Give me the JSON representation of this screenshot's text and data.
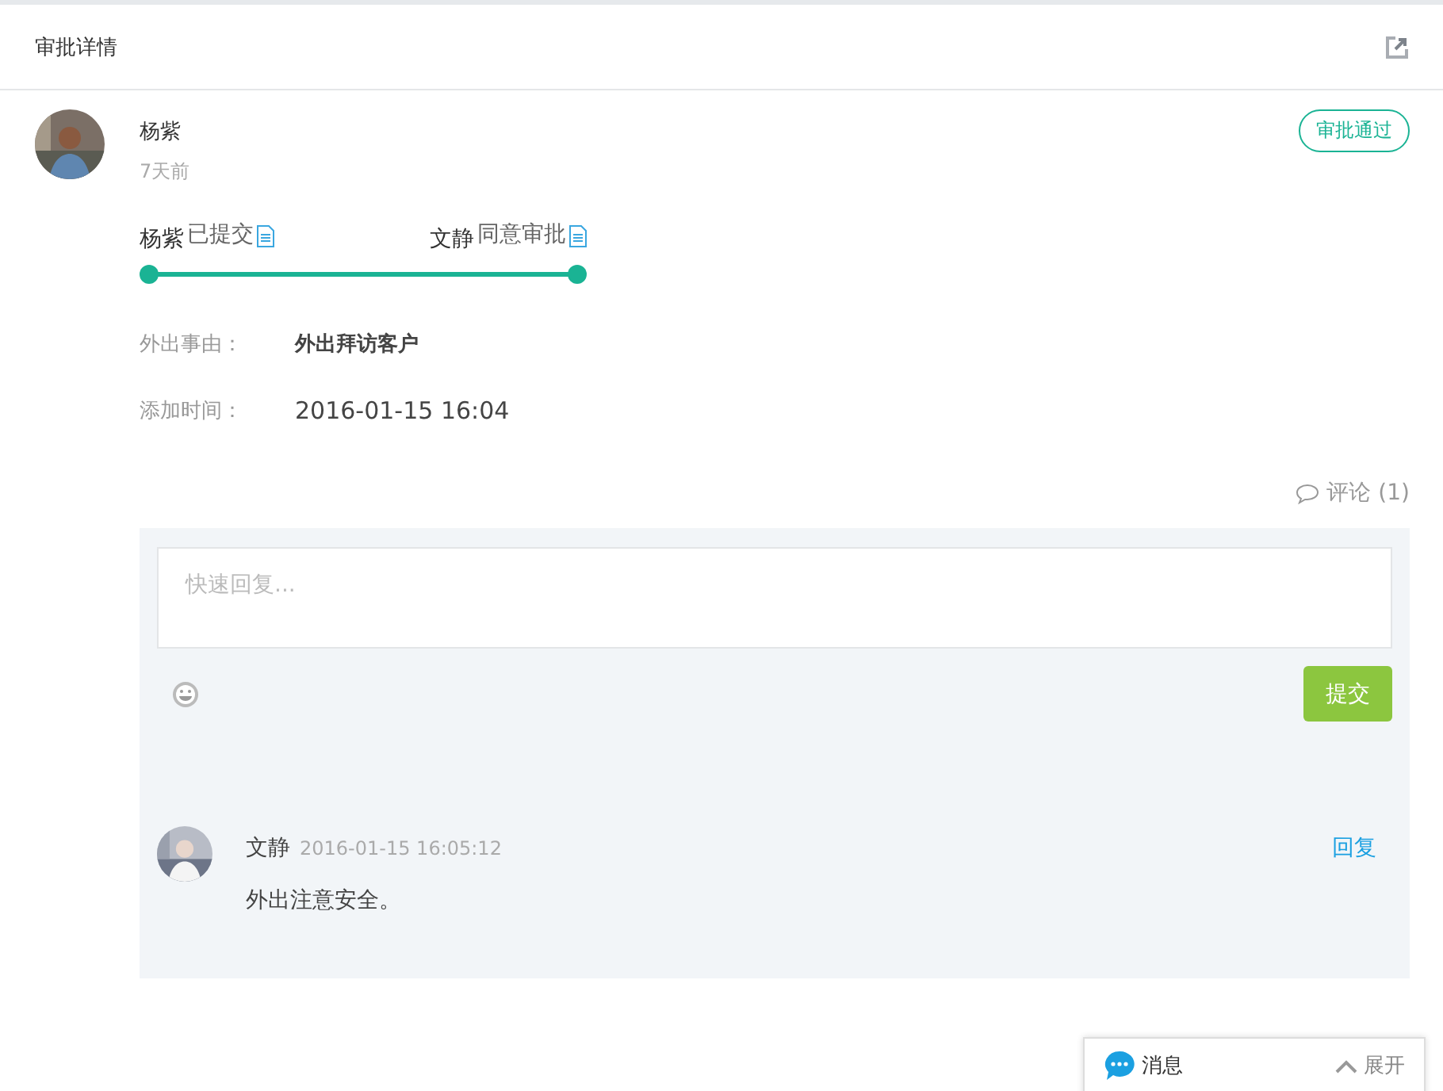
{
  "header": {
    "title": "审批详情"
  },
  "applicant": {
    "name": "杨紫",
    "time": "7天前",
    "status": "审批通过"
  },
  "timeline": [
    {
      "name": "杨紫",
      "action": "已提交"
    },
    {
      "name": "文静",
      "action": "同意审批"
    }
  ],
  "fields": [
    {
      "label": "外出事由：",
      "value": "外出拜访客户",
      "kind": "bold"
    },
    {
      "label": "添加时间：",
      "value": "2016-01-15 16:04",
      "kind": "large"
    }
  ],
  "comments_link": "评论 (1)",
  "reply": {
    "placeholder": "快速回复...",
    "submit": "提交"
  },
  "comments": [
    {
      "name": "文静",
      "time": "2016-01-15 16:05:12",
      "reply": "回复",
      "text": "外出注意安全。"
    }
  ],
  "message_bar": {
    "label": "消息",
    "expand": "展开"
  }
}
